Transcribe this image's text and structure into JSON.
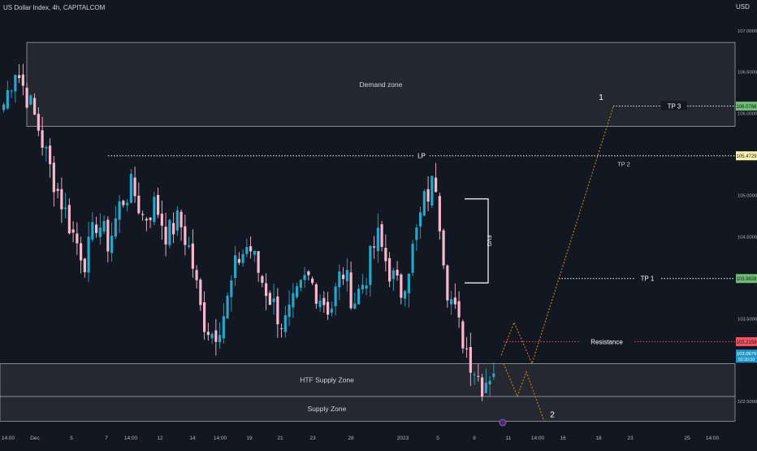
{
  "header": {
    "symbol_title": "US Dollar Index, 4h, CAPITALCOM",
    "currency": "USD"
  },
  "colors": {
    "background": "#131722",
    "bull": "#26a6c8",
    "bear": "#f7b9cc",
    "projection": "#e08a1e",
    "zone_fill": "#2a2d35",
    "zone_border": "#9aa0a8",
    "tp3_tag": "#6fbf73",
    "lp_tag": "#fff3b0",
    "tp1_tag": "#6fbf73",
    "resistance_tag": "#f7525f",
    "price_tag": "#2196c8"
  },
  "chart_data": {
    "type": "candlestick",
    "title": "US Dollar Index, 4h, CAPITALCOM",
    "ylabel": "USD",
    "ylim": [
      102.25,
      107.15
    ],
    "y_ticks": [
      "107.0000",
      "106.5000",
      "106.0000",
      "105.0000",
      "104.5000",
      "103.5000",
      "102.5000"
    ],
    "y_tick_values": [
      107.0,
      106.5,
      106.0,
      105.0,
      104.5,
      103.5,
      102.5
    ],
    "x_ticks": [
      "14:00",
      "Dec",
      "5",
      "7",
      "14:00",
      "12",
      "14",
      "14:00",
      "19",
      "21",
      "23",
      "28",
      "2023",
      "5",
      "9",
      "11",
      "14:00",
      "16",
      "18",
      "23",
      "25",
      "14:00"
    ],
    "candles_anchor_closes": [
      106.1,
      106.55,
      106.2,
      105.8,
      105.3,
      104.9,
      104.5,
      104.2,
      104.7,
      104.4,
      104.9,
      105.1,
      104.7,
      104.9,
      104.5,
      104.7,
      104.3,
      103.5,
      103.3,
      103.6,
      104.2,
      104.4,
      104.0,
      103.7,
      103.4,
      103.7,
      104.0,
      103.8,
      103.6,
      104.1,
      103.7,
      104.0,
      104.5,
      104.1,
      103.8,
      104.3,
      104.9,
      105.2,
      103.9,
      103.4,
      103.0,
      102.7,
      102.9
    ],
    "zones": [
      {
        "label": "Demand zone",
        "top": 106.85,
        "bottom": 105.83
      },
      {
        "label": "HTF Supply  Zone",
        "top": 102.95,
        "bottom": 102.55
      },
      {
        "label": "Supply Zone",
        "top": 102.55,
        "bottom": 102.25
      }
    ],
    "levels": [
      {
        "label": "TP 3",
        "value": 106.0768,
        "tag": "106.0768"
      },
      {
        "label": "LP",
        "value": 105.4729,
        "tag": "105.4729"
      },
      {
        "label": "TP 2",
        "value": 105.4729,
        "tag": ""
      },
      {
        "label": "TP 1",
        "value": 103.9828,
        "tag": "103.9828"
      },
      {
        "label": "Resistance",
        "value": 103.2159,
        "tag": "103.2159"
      }
    ],
    "current_price": {
      "tag_top": "103.0679",
      "tag_bottom": "00:30:59"
    },
    "fvg_label": "FVG",
    "projection_labels": [
      "1",
      "2"
    ]
  }
}
